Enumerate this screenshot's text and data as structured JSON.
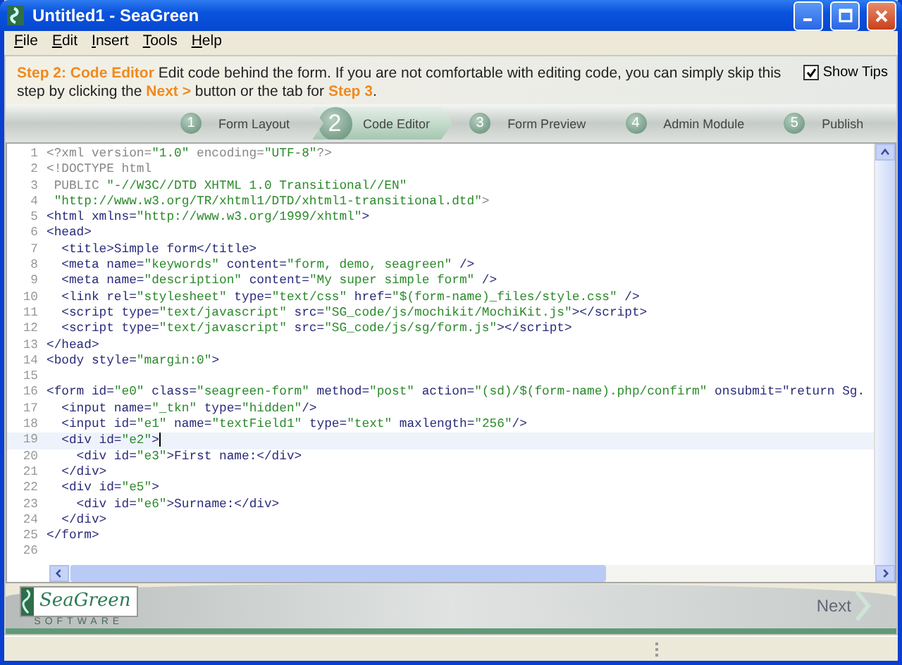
{
  "window": {
    "title": "Untitled1 - SeaGreen"
  },
  "menu": [
    {
      "label": "File"
    },
    {
      "label": "Edit"
    },
    {
      "label": "Insert"
    },
    {
      "label": "Tools"
    },
    {
      "label": "Help"
    }
  ],
  "tip": {
    "text": "**Step 2: Code Editor**  Edit code behind the form.  If you are not comfortable with editing code, you can simply skip this step by clicking the **Next >** button or the tab for **Step 3**.",
    "show_tips": {
      "label": "Show Tips",
      "checked": true
    }
  },
  "steps": [
    {
      "number": "1",
      "label": "Form Layout",
      "selected": false
    },
    {
      "number": "2",
      "label": "Code Editor",
      "selected": true
    },
    {
      "number": "3",
      "label": "Form Preview",
      "selected": false
    },
    {
      "number": "4",
      "label": "Admin Module",
      "selected": false
    },
    {
      "number": "5",
      "label": "Publish",
      "selected": false
    }
  ],
  "editor": {
    "lines": [
      {
        "number": "1",
        "kind": "prolog",
        "text": "<?xml version=\"1.0\" encoding=\"UTF-8\"?>"
      },
      {
        "number": "2",
        "kind": "prolog",
        "text": "<!DOCTYPE html"
      },
      {
        "number": "3",
        "kind": "prolog",
        "text": " PUBLIC \"-//W3C//DTD XHTML 1.0 Transitional//EN\""
      },
      {
        "number": "4",
        "kind": "prolog",
        "text": " \"http://www.w3.org/TR/xhtml1/DTD/xhtml1-transitional.dtd\">"
      },
      {
        "number": "5",
        "kind": "markup",
        "text": "<html xmlns=\"http://www.w3.org/1999/xhtml\">"
      },
      {
        "number": "6",
        "kind": "markup",
        "text": "<head>"
      },
      {
        "number": "7",
        "kind": "markup",
        "text": "  <title>Simple form</title>"
      },
      {
        "number": "8",
        "kind": "markup",
        "text": "  <meta name=\"keywords\" content=\"form, demo, seagreen\" />"
      },
      {
        "number": "9",
        "kind": "markup",
        "text": "  <meta name=\"description\" content=\"My super simple form\" />"
      },
      {
        "number": "10",
        "kind": "markup",
        "text": "  <link rel=\"stylesheet\" type=\"text/css\" href=\"$(form-name)_files/style.css\" />"
      },
      {
        "number": "11",
        "kind": "markup",
        "text": "  <script type=\"text/javascript\" src=\"SG_code/js/mochikit/MochiKit.js\"></script>"
      },
      {
        "number": "12",
        "kind": "markup",
        "text": "  <script type=\"text/javascript\" src=\"SG_code/js/sg/form.js\"></script>"
      },
      {
        "number": "13",
        "kind": "markup",
        "text": "</head>"
      },
      {
        "number": "14",
        "kind": "markup",
        "text": "<body style=\"margin:0\">"
      },
      {
        "number": "15",
        "kind": "markup"
      },
      {
        "number": "16",
        "kind": "markup",
        "text": "<form id=\"e0\" class=\"seagreen-form\" method=\"post\" action=\"(sd)/$(form-name).php/confirm\" onsubmit=\"return Sg."
      },
      {
        "number": "17",
        "kind": "markup",
        "text": "  <input name=\"_tkn\" type=\"hidden\"/>"
      },
      {
        "number": "18",
        "kind": "markup",
        "text": "  <input id=\"e1\" name=\"textField1\" type=\"text\" maxlength=\"256\"/>"
      },
      {
        "number": "19",
        "kind": "markup",
        "text": "  <div id=\"e2\">",
        "current": true
      },
      {
        "number": "20",
        "kind": "markup",
        "text": "    <div id=\"e3\">First name:</div>"
      },
      {
        "number": "21",
        "kind": "markup",
        "text": "  </div>"
      },
      {
        "number": "22",
        "kind": "markup",
        "text": "  <div id=\"e5\">"
      },
      {
        "number": "23",
        "kind": "markup",
        "text": "    <div id=\"e6\">Surname:</div>"
      },
      {
        "number": "24",
        "kind": "markup",
        "text": "  </div>"
      },
      {
        "number": "25",
        "kind": "markup",
        "text": "</form>"
      },
      {
        "number": "26",
        "kind": "markup"
      }
    ]
  },
  "footer": {
    "logo": {
      "name": "SeaGreen",
      "sub": "SOFTWARE"
    },
    "next": "Next"
  }
}
